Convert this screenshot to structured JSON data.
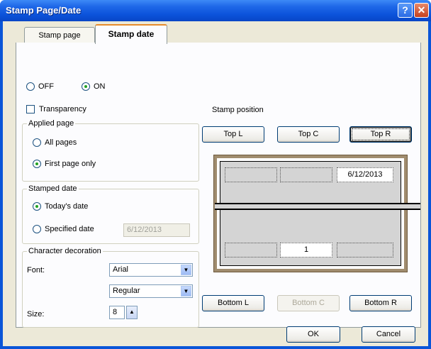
{
  "window": {
    "title": "Stamp Page/Date",
    "help_glyph": "?",
    "close_glyph": "✕"
  },
  "tabs": [
    {
      "label": "Stamp page"
    },
    {
      "label": "Stamp date"
    }
  ],
  "mode": {
    "off_label": "OFF",
    "on_label": "ON",
    "selected": "ON"
  },
  "transparency": {
    "label": "Transparency",
    "checked": false
  },
  "applied_page": {
    "title": "Applied page",
    "options": [
      {
        "label": "All pages",
        "selected": false
      },
      {
        "label": "First page only",
        "selected": true
      }
    ]
  },
  "stamped_date": {
    "title": "Stamped date",
    "todays_label": "Today's date",
    "specified_label": "Specified date",
    "specified_value": "6/12/2013",
    "selected": "today"
  },
  "character_decoration": {
    "title": "Character decoration",
    "font_label": "Font:",
    "font_value": "Arial",
    "style_value": "Regular",
    "size_label": "Size:",
    "size_value": "8"
  },
  "stamp_position": {
    "label": "Stamp position",
    "top_buttons": [
      "Top L",
      "Top C",
      "Top R"
    ],
    "bottom_buttons": [
      "Bottom L",
      "Bottom C",
      "Bottom R"
    ],
    "selected": "Top R",
    "disabled": "Bottom C",
    "preview_date_text": "6/12/2013",
    "preview_page_number": "1"
  },
  "footer": {
    "ok_label": "OK",
    "cancel_label": "Cancel"
  },
  "icons": {
    "dropdown": "▼",
    "spin_up": "▲"
  },
  "colors": {
    "titlebar": "#0b52da",
    "face": "#ece9d8",
    "tab_accent": "#e68b2c",
    "preview_frame": "#a08c6e"
  }
}
